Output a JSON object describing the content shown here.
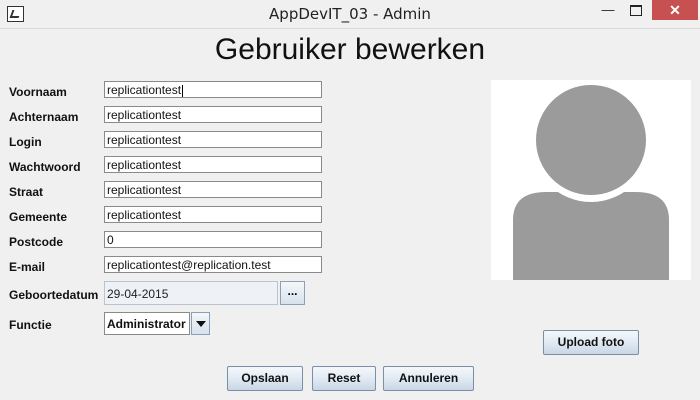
{
  "window": {
    "title": "AppDevIT_03 - Admin",
    "minimize": "—",
    "close": "✕"
  },
  "form": {
    "title": "Gebruiker bewerken",
    "fields": [
      {
        "label": "Voornaam",
        "value": "replicationtest"
      },
      {
        "label": "Achternaam",
        "value": "replicationtest"
      },
      {
        "label": "Login",
        "value": "replicationtest"
      },
      {
        "label": "Wachtwoord",
        "value": "replicationtest"
      },
      {
        "label": "Straat",
        "value": "replicationtest"
      },
      {
        "label": "Gemeente",
        "value": "replicationtest"
      },
      {
        "label": "Postcode",
        "value": "0"
      },
      {
        "label": "E-mail",
        "value": "replicationtest@replication.test"
      }
    ],
    "birthdate": {
      "label": "Geboortedatum",
      "value": "29-04-2015",
      "button": "..."
    },
    "function": {
      "label": "Functie",
      "value": "Administrator"
    }
  },
  "photo": {
    "upload_label": "Upload foto",
    "avatar_color": "#9b9b9b"
  },
  "actions": {
    "save": "Opslaan",
    "reset": "Reset",
    "cancel": "Annuleren"
  }
}
